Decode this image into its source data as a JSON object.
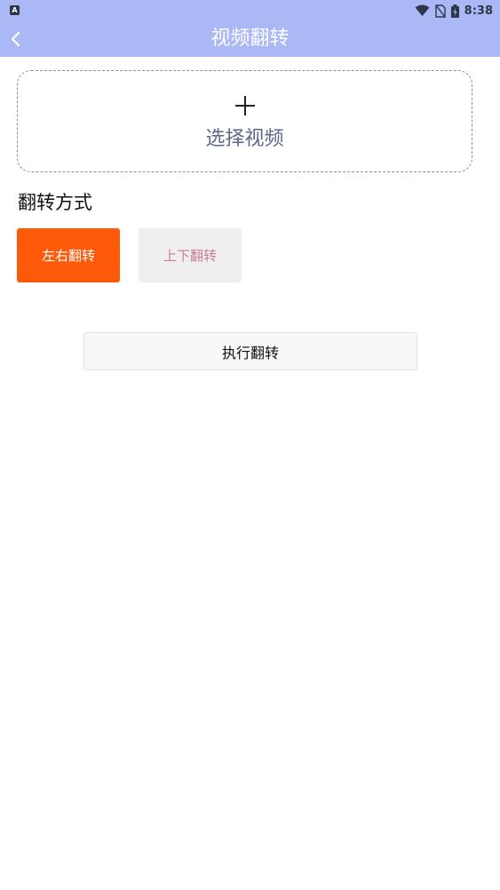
{
  "status_bar": {
    "left_icon_letter": "A",
    "time": "8:38",
    "icons": [
      "wifi-icon",
      "no-sim-icon",
      "battery-charging-icon"
    ]
  },
  "app_bar": {
    "title": "视频翻转",
    "back_icon": "chevron-left-icon",
    "background_color": "#aab8f5"
  },
  "picker": {
    "icon": "plus-icon",
    "label": "选择视频"
  },
  "flip_section": {
    "title": "翻转方式",
    "options": [
      {
        "label": "左右翻转",
        "selected": true,
        "color": "#ff5a0a"
      },
      {
        "label": "上下翻转",
        "selected": false,
        "color": "#efefef"
      }
    ]
  },
  "actions": {
    "execute_label": "执行翻转"
  }
}
